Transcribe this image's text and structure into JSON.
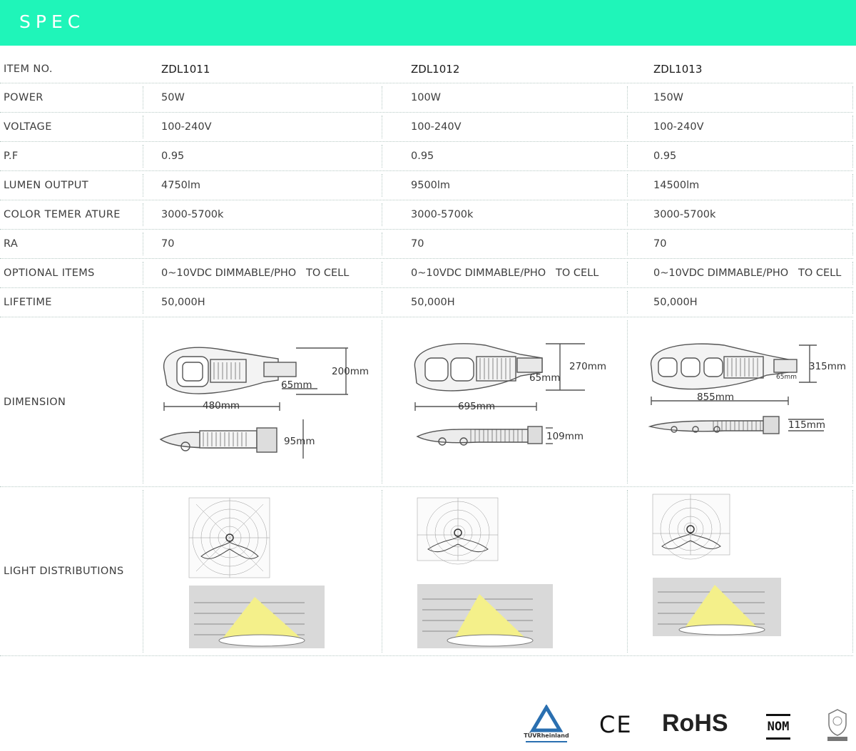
{
  "header": {
    "title": "SPEC"
  },
  "columns": [
    "ZDL1011",
    "ZDL1012",
    "ZDL1013"
  ],
  "rows": [
    {
      "label": "POWER",
      "values": [
        "50W",
        "100W",
        "150W"
      ]
    },
    {
      "label": "VOLTAGE",
      "values": [
        "100-240V",
        "100-240V",
        "100-240V"
      ]
    },
    {
      "label": "P.F",
      "values": [
        "0.95",
        "0.95",
        "0.95"
      ]
    },
    {
      "label": "LUMEN OUTPUT",
      "values": [
        "4750lm",
        "9500lm",
        "14500lm"
      ]
    },
    {
      "label": "COLOR TEMER ATURE",
      "values": [
        "3000-5700k",
        "3000-5700k",
        "3000-5700k"
      ]
    },
    {
      "label": "RA",
      "values": [
        "70",
        "70",
        "70"
      ]
    },
    {
      "label": "OPTIONAL ITEMS",
      "values": [
        "0~10VDC DIMMABLE/PHO   TO CELL",
        "0~10VDC DIMMABLE/PHO   TO CELL",
        "0~10VDC DIMMABLE/PHO   TO CELL"
      ]
    },
    {
      "label": "LIFETIME",
      "values": [
        "50,000H",
        "50,000H",
        "50,000H"
      ]
    }
  ],
  "item_no_label": "ITEM NO.",
  "dimension": {
    "label": "DIMENSION",
    "models": [
      {
        "length": "480mm",
        "height": "200mm",
        "arm": "65mm",
        "thickness": "95mm"
      },
      {
        "length": "695mm",
        "height": "270mm",
        "arm": "65mm",
        "thickness": "109mm"
      },
      {
        "length": "855mm",
        "height": "315mm",
        "arm": "65mm",
        "thickness": "115mm"
      }
    ]
  },
  "light_distribution": {
    "label": "LIGHT DISTRIBUTIONS"
  },
  "certifications": {
    "tuv": "TÜVRheinland",
    "ce": "CE",
    "rohs": "RoHS",
    "nom": "NOM"
  },
  "colors": {
    "header": "#1ff5b9",
    "grid": "#b6c9c4",
    "beam": "#f4f08a"
  }
}
